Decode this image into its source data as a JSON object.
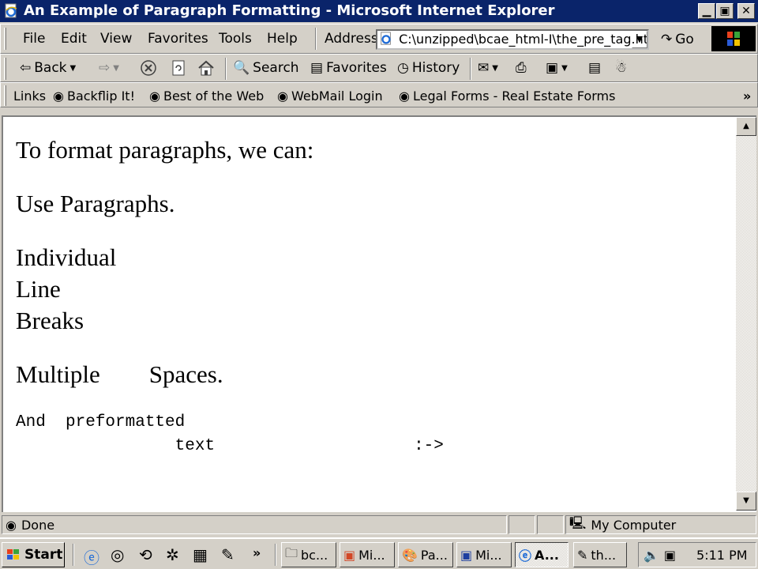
{
  "window": {
    "title": "An Example of Paragraph Formatting - Microsoft Internet Explorer",
    "icon": "ie-page-icon",
    "controls": [
      "minimize",
      "maximize",
      "close"
    ]
  },
  "menu": [
    "File",
    "Edit",
    "View",
    "Favorites",
    "Tools",
    "Help"
  ],
  "address": {
    "label": "Address",
    "value": "C:\\unzipped\\bcae_html-I\\the_pre_tag.ht",
    "go_label": "Go"
  },
  "toolbar": {
    "back": "Back",
    "search": "Search",
    "favorites": "Favorites",
    "history": "History"
  },
  "links": {
    "label": "Links",
    "items": [
      "Backflip It!",
      "Best of the Web",
      "WebMail Login",
      "Legal Forms - Real Estate Forms"
    ],
    "overflow": "»"
  },
  "page": {
    "p1": "To format paragraphs, we can:",
    "p2": "Use Paragraphs.",
    "p3_lines": [
      "Individual",
      "Line",
      "Breaks"
    ],
    "p4": "Multiple        Spaces.",
    "pre": "And  preformatted\n                text                    :->"
  },
  "status": {
    "text": "Done",
    "zone": "My Computer"
  },
  "taskbar": {
    "start": "Start",
    "quick_launch_overflow": "»",
    "tasks": [
      "bc...",
      "Mi...",
      "Pa...",
      "Mi...",
      "A...",
      "th..."
    ],
    "active_task_index": 4,
    "clock": "5:11 PM"
  },
  "colors": {
    "titlebar": "#0a246a",
    "chrome": "#d4d0c8",
    "page_background": "#ffffff"
  }
}
